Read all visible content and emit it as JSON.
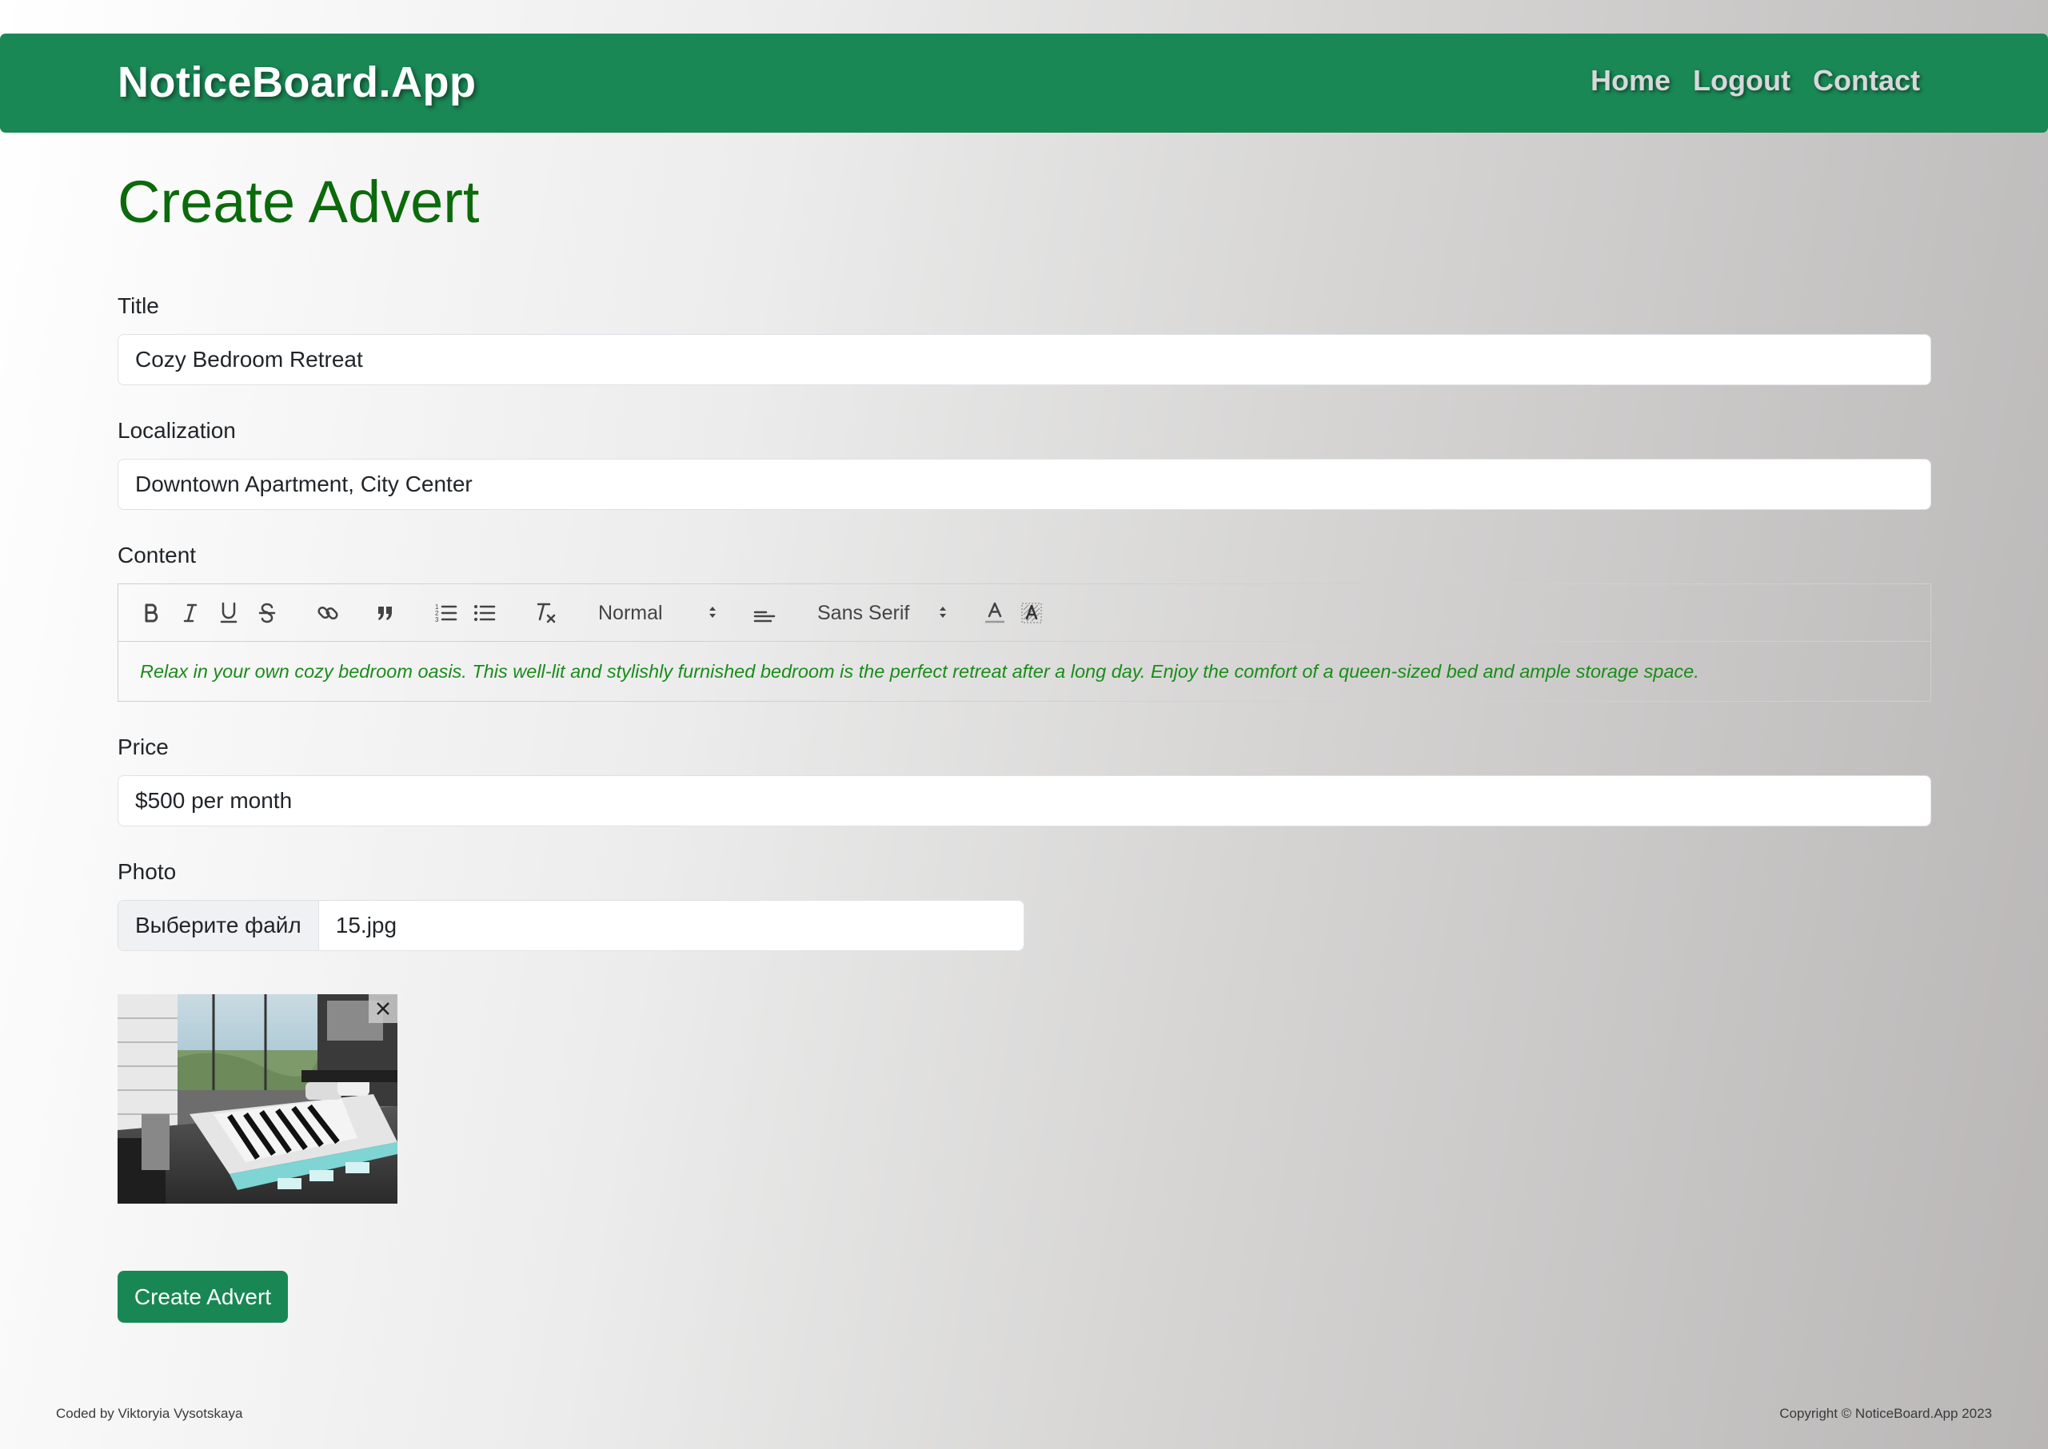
{
  "navbar": {
    "brand": "NoticeBoard.App",
    "links": [
      "Home",
      "Logout",
      "Contact"
    ]
  },
  "page": {
    "title": "Create Advert"
  },
  "form": {
    "title": {
      "label": "Title",
      "value": "Cozy Bedroom Retreat"
    },
    "localization": {
      "label": "Localization",
      "value": "Downtown Apartment, City Center"
    },
    "content": {
      "label": "Content",
      "toolbar": {
        "header_select": "Normal",
        "font_select": "Sans Serif"
      },
      "text": "Relax in your own cozy bedroom oasis. This well-lit and stylishly furnished bedroom is the perfect retreat after a long day. Enjoy the comfort of a queen-sized bed and ample storage space.",
      "text_color": "#1a8c1a"
    },
    "price": {
      "label": "Price",
      "value": "$500 per month"
    },
    "photo": {
      "label": "Photo",
      "button": "Выберите файл",
      "file_name": "15.jpg"
    },
    "submit_label": "Create Advert"
  },
  "footer": {
    "left": "Coded by Viktoryia Vysotskaya",
    "right": "Copyright © NoticeBoard.App 2023"
  },
  "colors": {
    "navbar": "#1a8855",
    "title": "#0b6a0b",
    "button": "#198754"
  }
}
